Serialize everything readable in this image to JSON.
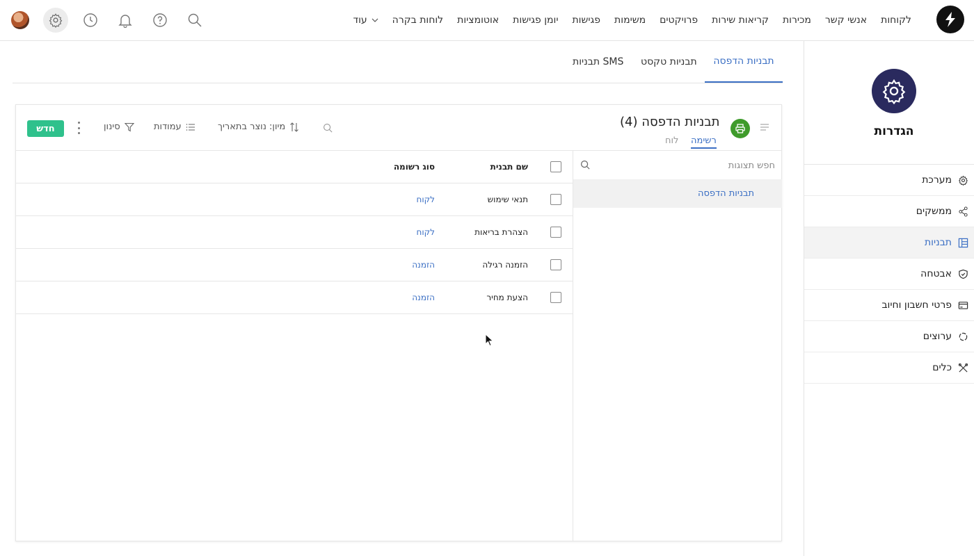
{
  "nav": {
    "items": [
      "לקוחות",
      "אנשי קשר",
      "מכירות",
      "קריאות שירות",
      "פרויקטים",
      "משימות",
      "פגישות",
      "יומן פגישות",
      "אוטומציות",
      "לוחות בקרה"
    ],
    "more_label": "עוד"
  },
  "topicons": [
    "settings-icon",
    "clock-icon",
    "bell-icon",
    "help-icon",
    "search-icon"
  ],
  "sidebar": {
    "title": "הגדרות",
    "items": [
      {
        "label": "מערכת",
        "icon": "gear-icon"
      },
      {
        "label": "ממשקים",
        "icon": "share-icon"
      },
      {
        "label": "תבניות",
        "icon": "template-icon",
        "active": true
      },
      {
        "label": "אבטחה",
        "icon": "shield-icon"
      },
      {
        "label": "פרטי חשבון וחיוב",
        "icon": "credit-card-icon"
      },
      {
        "label": "ערוצים",
        "icon": "channels-icon"
      },
      {
        "label": "כלים",
        "icon": "tools-icon"
      }
    ]
  },
  "tabs": [
    "תבניות הדפסה",
    "תבניות טקסט",
    "תבניות SMS"
  ],
  "panel": {
    "title": "תבניות הדפסה",
    "count": "(4)",
    "subtabs": [
      "רשימה",
      "לוח"
    ],
    "sort_label": "מיון: נוצר בתאריך",
    "columns_label": "עמודות",
    "filter_label": "סינון",
    "new_label": "חדש"
  },
  "folders": {
    "search_placeholder": "חפש תצוגות",
    "items": [
      "תבניות הדפסה"
    ]
  },
  "table": {
    "headers": {
      "name": "שם תבנית",
      "type": "סוג רשומה"
    },
    "rows": [
      {
        "name": "תנאי שימוש",
        "type": "לקוח"
      },
      {
        "name": "הצהרת בריאות",
        "type": "לקוח"
      },
      {
        "name": "הזמנה רגילה",
        "type": "הזמנה"
      },
      {
        "name": "הצעת מחיר",
        "type": "הזמנה"
      }
    ]
  },
  "colors": {
    "accent": "#3b6fc4",
    "new_button": "#2fc18c",
    "printer_badge": "#3f9b2b",
    "settings_badge": "#2a2a5e"
  }
}
